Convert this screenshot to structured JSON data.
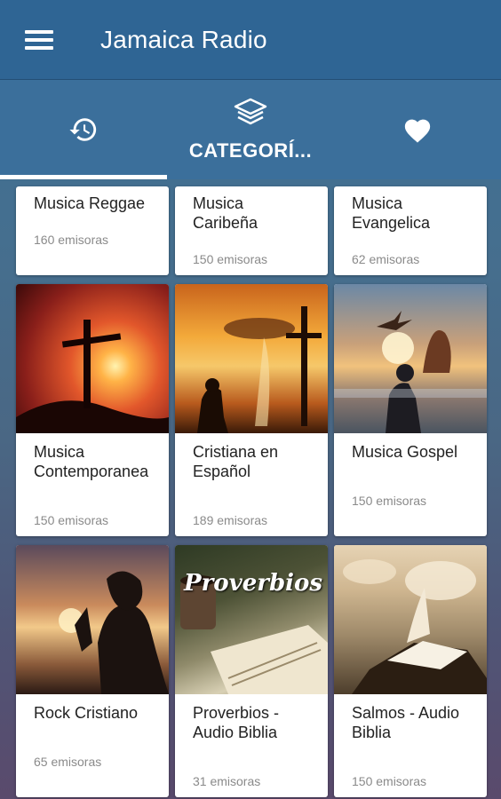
{
  "app": {
    "title": "Jamaica Radio"
  },
  "tabs": [
    {
      "icon": "history-icon",
      "label": ""
    },
    {
      "icon": "layers-icon",
      "label": "CATEGORÍ..."
    },
    {
      "icon": "heart-icon",
      "label": ""
    }
  ],
  "categories_partial": [
    {
      "title": "Musica Reggae",
      "count": "160 emisoras"
    },
    {
      "title": "Musica Caribeña",
      "count": "150 emisoras"
    },
    {
      "title": "Musica Evangelica",
      "count": "62 emisoras"
    }
  ],
  "categories": [
    {
      "title": "Musica Contemporanea",
      "count": "150 emisoras",
      "image": "cross-sunset"
    },
    {
      "title": "Cristiana en Español",
      "count": "189 emisoras",
      "image": "praying-cross"
    },
    {
      "title": "Musica Gospel",
      "count": "150 emisoras",
      "image": "bird-sunset"
    },
    {
      "title": "Rock Cristiano",
      "count": "65 emisoras",
      "image": "prayer-silhouette"
    },
    {
      "title": "Proverbios - Audio Biblia",
      "count": "31 emisoras",
      "image": "bible-coffee",
      "image_text": "Proverbios"
    },
    {
      "title": "Salmos - Audio Biblia",
      "count": "150 emisoras",
      "image": "open-book-sky"
    }
  ],
  "colors": {
    "appbar": "#2f6594",
    "tabbar": "#3b6f9b",
    "indicator": "#ffffff"
  }
}
